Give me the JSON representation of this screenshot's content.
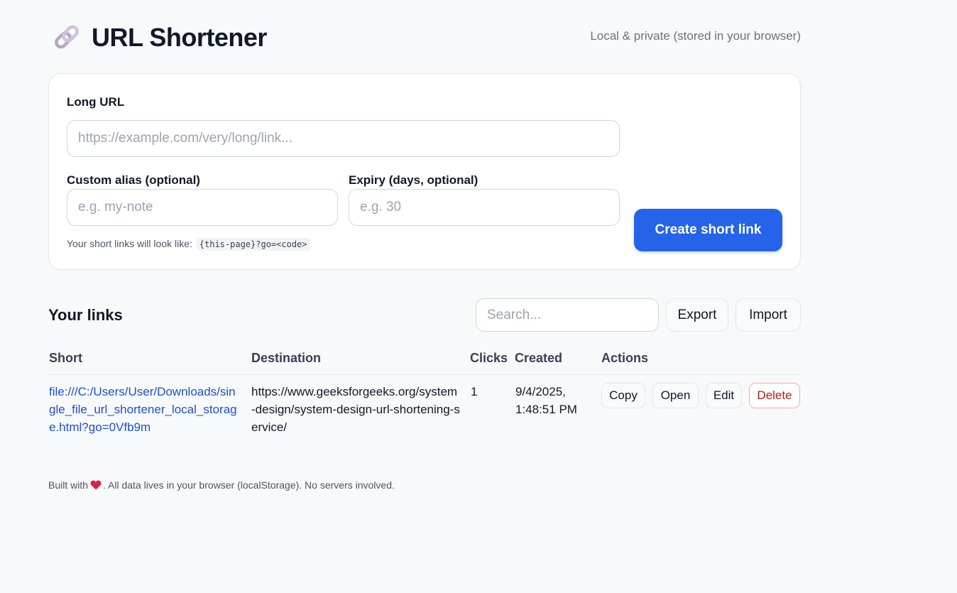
{
  "header": {
    "title": "URL Shortener",
    "tagline": "Local & private (stored in your browser)"
  },
  "form": {
    "long_url_label": "Long URL",
    "long_url_placeholder": "https://example.com/very/long/link...",
    "alias_label": "Custom alias (optional)",
    "alias_placeholder": "e.g. my-note",
    "expiry_label": "Expiry (days, optional)",
    "expiry_placeholder": "e.g. 30",
    "hint_text": "Your short links will look like:",
    "hint_code": "{this-page}?go=<code>",
    "create_button": "Create short link"
  },
  "links": {
    "title": "Your links",
    "search_placeholder": "Search...",
    "export_label": "Export",
    "import_label": "Import",
    "columns": [
      "Short",
      "Destination",
      "Clicks",
      "Created",
      "Actions"
    ],
    "rows": [
      {
        "short": "file:///C:/Users/User/Downloads/single_file_url_shortener_local_storage.html?go=0Vfb9m",
        "destination": "https://www.geeksforgeeks.org/system-design/system-design-url-shortening-service/",
        "clicks": "1",
        "created": "9/4/2025, 1:48:51 PM",
        "actions": [
          "Copy",
          "Open",
          "Edit",
          "Delete"
        ]
      }
    ]
  },
  "footer": {
    "before": "Built with",
    "after": ". All data lives in your browser (localStorage). No servers involved."
  },
  "colors": {
    "accent": "#2563eb",
    "link": "#1d4ed8",
    "danger": "#b91c1c",
    "heart": "#e11d48"
  },
  "icons": {
    "logo": "link-icon",
    "footer": "heart-icon"
  }
}
